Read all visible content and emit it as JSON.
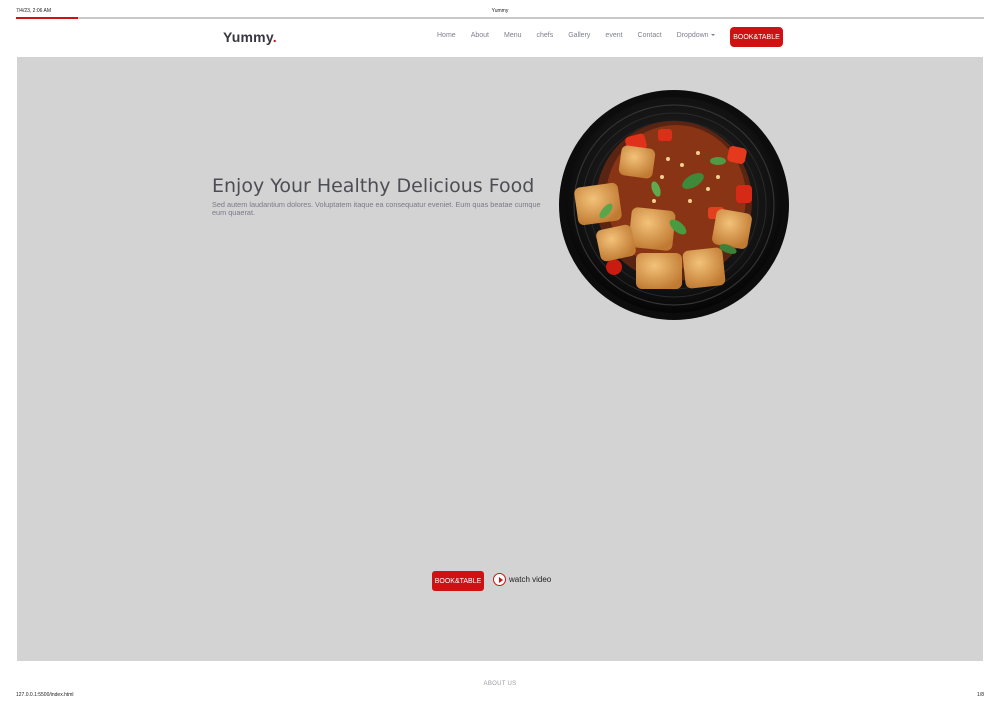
{
  "print_header": {
    "datetime": "7/4/23, 2:06 AM",
    "title": "Yummy"
  },
  "progress": {
    "fraction": 0.064,
    "color": "#ce1212"
  },
  "navbar": {
    "logo_text": "Yummy",
    "logo_dot": ".",
    "links": [
      "Home",
      "About",
      "Menu",
      "chefs",
      "Gallery",
      "event",
      "Contact"
    ],
    "dropdown_label": "Dropdown",
    "cta_label": "BOOK&TABLE"
  },
  "hero": {
    "title": "Enjoy Your Healthy Delicious Food",
    "subtitle": "Sed autem laudantium dolores. Voluptatem itaque ea consequatur eveniet. Eum quas beatae cumque eum quaerat.",
    "book_label": "BOOK&TABLE",
    "watch_label": "watch video",
    "image_icon": "food-plate-image"
  },
  "sections": {
    "about_heading": "ABOUT US"
  },
  "print_footer": {
    "url": "127.0.0.1:5500/index.html",
    "page": "1/8"
  },
  "colors": {
    "accent": "#ce1212",
    "hero_bg": "#d3d3d4",
    "text_dark": "#37373f"
  }
}
